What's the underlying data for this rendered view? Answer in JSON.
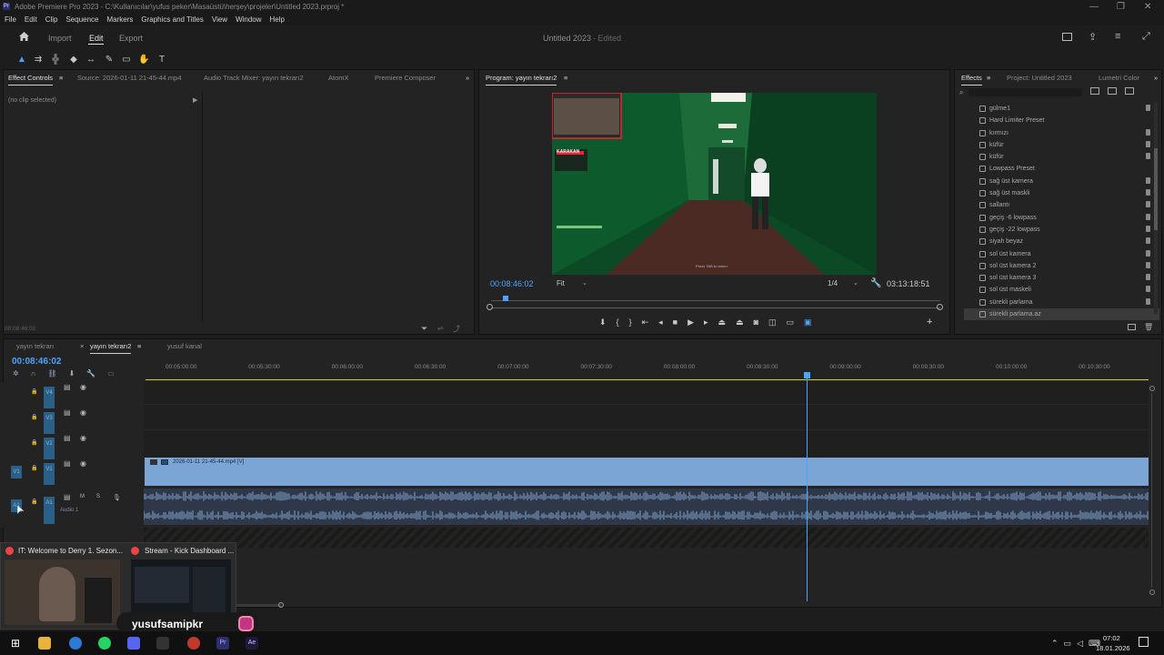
{
  "window": {
    "title": "Adobe Premiere Pro 2023 - C:\\Kullanıcılar\\yufus peker\\Masaüstü\\herşey\\projeler\\Untitled 2023.prproj *"
  },
  "menu": [
    "File",
    "Edit",
    "Clip",
    "Sequence",
    "Markers",
    "Graphics and Titles",
    "View",
    "Window",
    "Help"
  ],
  "workspace": {
    "tabs": [
      "Import",
      "Edit",
      "Export"
    ],
    "active": "Edit",
    "project_title": "Untitled 2023",
    "project_status": "- Edited"
  },
  "source_panel": {
    "tabs": [
      "Effect Controls",
      "Source: 2026-01-11 21-45-44.mp4",
      "Audio Track Mixer: yayın tekrarı2",
      "AtomX",
      "Premiere Composer"
    ],
    "no_clip": "(no clip selected)",
    "timecode": "00:08:46:02"
  },
  "program": {
    "title": "Program: yayın tekrarı2",
    "timecode": "00:08:46:02",
    "zoom": "Fit",
    "resolution": "1/4",
    "duration": "03:13:18:51",
    "overlay_texts": [
      "KARAKAN"
    ],
    "caption": "Press TAB to return"
  },
  "effects": {
    "tabs": [
      "Effects",
      "Project: Untitled 2023",
      "Lumetri Color"
    ],
    "items": [
      {
        "name": "gülme1",
        "trash": true
      },
      {
        "name": "Hard Limiter Preset",
        "trash": false
      },
      {
        "name": "kırmızı",
        "trash": true
      },
      {
        "name": "küfür",
        "trash": true
      },
      {
        "name": "küfür",
        "trash": true
      },
      {
        "name": "Lowpass Preset",
        "trash": false
      },
      {
        "name": "sağ üst kamera",
        "trash": true
      },
      {
        "name": "sağ üst maskli",
        "trash": true
      },
      {
        "name": "sallantı",
        "trash": true
      },
      {
        "name": "geçiş -6 lowpass",
        "trash": true
      },
      {
        "name": "geçiş -22 lowpass",
        "trash": true
      },
      {
        "name": "siyah beyaz",
        "trash": true
      },
      {
        "name": "sol üst kamera",
        "trash": true
      },
      {
        "name": "sol üst kamera 2",
        "trash": true
      },
      {
        "name": "sol üst kamera 3",
        "trash": true
      },
      {
        "name": "sol üst maskeli",
        "trash": true
      },
      {
        "name": "sürekli parlama",
        "trash": true
      },
      {
        "name": "sürekli parlama.az",
        "trash": false
      }
    ],
    "selected_index": 17
  },
  "timeline": {
    "tabs": [
      "yayın tekrarı",
      "yayın tekrarı2",
      "yusuf kanal"
    ],
    "active_tab": "yayın tekrarı2",
    "timecode": "00:08:46:02",
    "ruler": [
      "00:05:00:00",
      "00:05:30:00",
      "00:06:00:00",
      "00:06:30:00",
      "00:07:00:00",
      "00:07:30:00",
      "00:08:00:00",
      "00:08:30:00",
      "00:09:00:00",
      "00:09:30:00",
      "00:10:00:00",
      "00:10:30:00"
    ],
    "tracks": [
      "V4",
      "V3",
      "V2",
      "V1",
      "A1"
    ],
    "audio_label": "Audio 1",
    "clip_name": "2026-01-11 21-45-44.mp4 [V]",
    "playhead_fraction": 0.66
  },
  "taskbar_previews": [
    {
      "title": "IT: Welcome to Derry 1. Sezon..."
    },
    {
      "title": "Stream - Kick Dashboard ..."
    }
  ],
  "streamer": "yusufsamipkr",
  "clock": {
    "time": "07:02",
    "date": "18.01.2026"
  }
}
